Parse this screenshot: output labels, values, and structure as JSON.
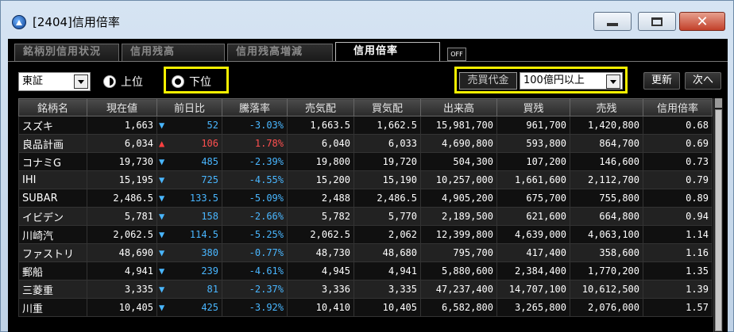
{
  "window": {
    "title": "[2404]信用倍率",
    "close_glyph": "✕"
  },
  "tabs": [
    {
      "label": "銘柄別信用状況",
      "active": false
    },
    {
      "label": "信用残高",
      "active": false
    },
    {
      "label": "信用残高増減",
      "active": false
    },
    {
      "label": "信用倍率",
      "active": true
    }
  ],
  "off_button": "OFF",
  "controls": {
    "market_select": "東証",
    "radio_top_label": "上位",
    "radio_bottom_label": "下位",
    "radio_selected": "下位",
    "turnover_label": "売買代金",
    "turnover_select": "100億円以上",
    "refresh_label": "更新",
    "next_label": "次へ"
  },
  "colors": {
    "highlight": "#f6f000",
    "up": "#ff5050",
    "down": "#49b6ff"
  },
  "table": {
    "columns": [
      "銘柄名",
      "現在値",
      "前日比",
      "騰落率",
      "売気配",
      "買気配",
      "出来高",
      "買残",
      "売残",
      "信用倍率"
    ],
    "rows": [
      {
        "name": "スズキ",
        "price": "1,663",
        "dir": "down",
        "change": "52",
        "rate": "-3.03%",
        "ask": "1,663.5",
        "bid": "1,662.5",
        "volume": "15,981,700",
        "buy_bal": "961,700",
        "sell_bal": "1,420,800",
        "ratio": "0.68"
      },
      {
        "name": "良品計画",
        "price": "6,034",
        "dir": "up",
        "change": "106",
        "rate": "1.78%",
        "ask": "6,040",
        "bid": "6,033",
        "volume": "4,690,800",
        "buy_bal": "593,800",
        "sell_bal": "864,700",
        "ratio": "0.69"
      },
      {
        "name": "コナミG",
        "price": "19,730",
        "dir": "down",
        "change": "485",
        "rate": "-2.39%",
        "ask": "19,800",
        "bid": "19,720",
        "volume": "504,300",
        "buy_bal": "107,200",
        "sell_bal": "146,600",
        "ratio": "0.73"
      },
      {
        "name": "IHI",
        "price": "15,195",
        "dir": "down",
        "change": "725",
        "rate": "-4.55%",
        "ask": "15,200",
        "bid": "15,190",
        "volume": "10,257,000",
        "buy_bal": "1,661,600",
        "sell_bal": "2,112,700",
        "ratio": "0.79"
      },
      {
        "name": "SUBAR",
        "price": "2,486.5",
        "dir": "down",
        "change": "133.5",
        "rate": "-5.09%",
        "ask": "2,488",
        "bid": "2,486.5",
        "volume": "4,905,200",
        "buy_bal": "675,700",
        "sell_bal": "755,800",
        "ratio": "0.89"
      },
      {
        "name": "イビデン",
        "price": "5,781",
        "dir": "down",
        "change": "158",
        "rate": "-2.66%",
        "ask": "5,782",
        "bid": "5,770",
        "volume": "2,189,500",
        "buy_bal": "621,600",
        "sell_bal": "664,800",
        "ratio": "0.94"
      },
      {
        "name": "川崎汽",
        "price": "2,062.5",
        "dir": "down",
        "change": "114.5",
        "rate": "-5.25%",
        "ask": "2,062.5",
        "bid": "2,062",
        "volume": "12,399,800",
        "buy_bal": "4,639,000",
        "sell_bal": "4,063,100",
        "ratio": "1.14"
      },
      {
        "name": "ファストリ",
        "price": "48,690",
        "dir": "down",
        "change": "380",
        "rate": "-0.77%",
        "ask": "48,730",
        "bid": "48,680",
        "volume": "795,700",
        "buy_bal": "417,400",
        "sell_bal": "358,600",
        "ratio": "1.16"
      },
      {
        "name": "郵船",
        "price": "4,941",
        "dir": "down",
        "change": "239",
        "rate": "-4.61%",
        "ask": "4,945",
        "bid": "4,941",
        "volume": "5,880,600",
        "buy_bal": "2,384,400",
        "sell_bal": "1,770,200",
        "ratio": "1.35"
      },
      {
        "name": "三菱重",
        "price": "3,335",
        "dir": "down",
        "change": "81",
        "rate": "-2.37%",
        "ask": "3,336",
        "bid": "3,335",
        "volume": "47,237,400",
        "buy_bal": "14,707,100",
        "sell_bal": "10,612,500",
        "ratio": "1.39"
      },
      {
        "name": "川重",
        "price": "10,405",
        "dir": "down",
        "change": "425",
        "rate": "-3.92%",
        "ask": "10,410",
        "bid": "10,405",
        "volume": "6,582,800",
        "buy_bal": "3,265,800",
        "sell_bal": "2,076,000",
        "ratio": "1.57"
      }
    ]
  }
}
